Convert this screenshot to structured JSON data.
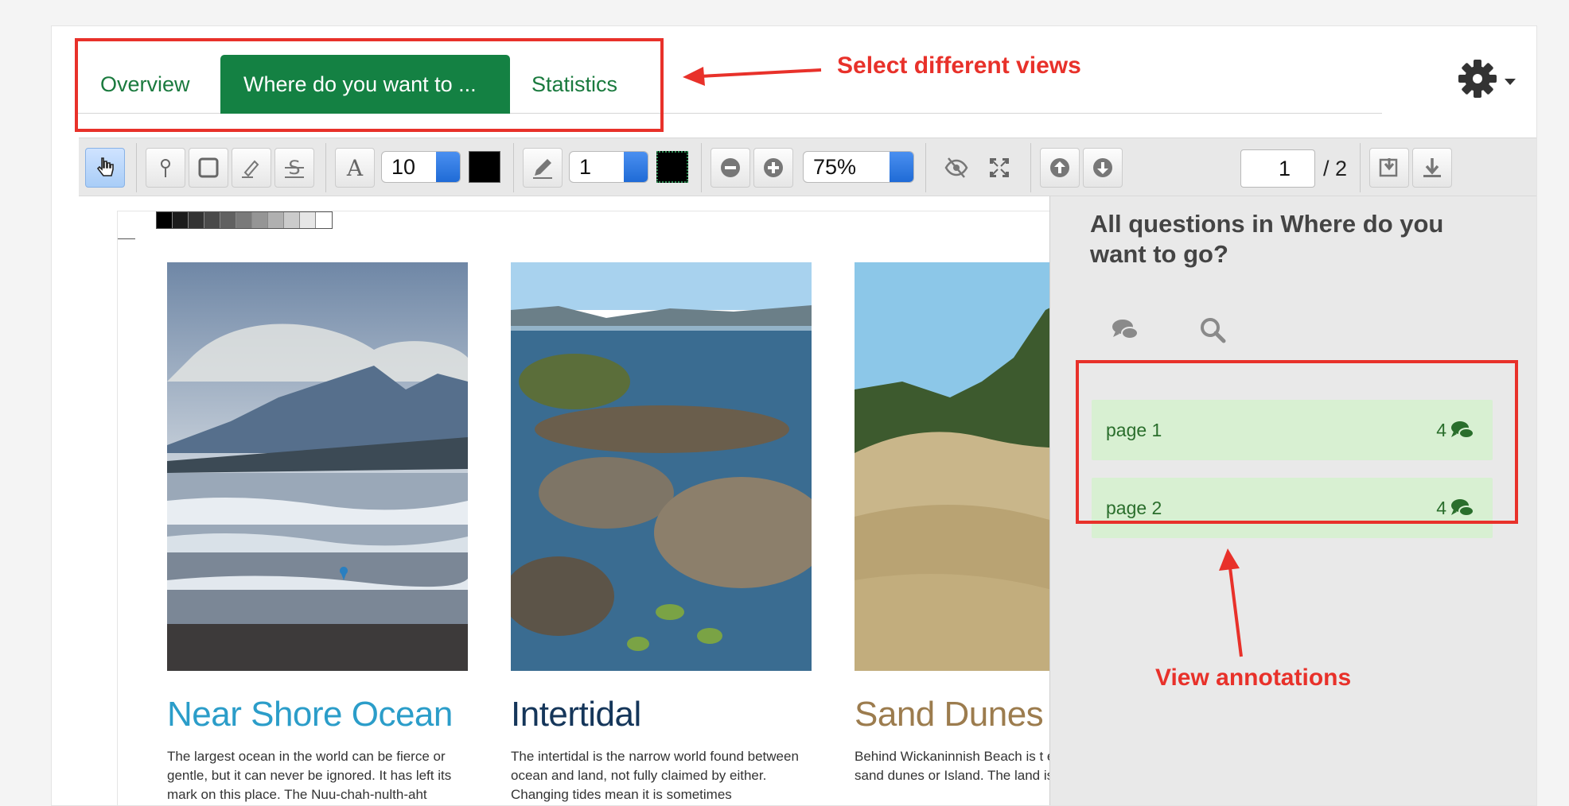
{
  "tabs": [
    {
      "label": "Overview"
    },
    {
      "label": "Where do you want to ..."
    },
    {
      "label": "Statistics"
    }
  ],
  "toolbar": {
    "font_size": "10",
    "line_width": "1",
    "zoom": "75%",
    "page_current": "1",
    "page_total": "/ 2"
  },
  "document": {
    "columns": [
      {
        "title": "Near Shore Ocean",
        "text": "The largest ocean in the world can be fierce or gentle, but it can never be ignored. It has left its mark on this place. The Nuu-chah-nulth-aht"
      },
      {
        "title": "Intertidal",
        "text": "The intertidal is the narrow world found between ocean and land, not fully claimed by either. Changing tides mean it is sometimes"
      },
      {
        "title": "Sand Dunes",
        "text": "Behind Wickaninnish Beach is t extensive area of sand dunes or Island. The land is low enough f"
      }
    ]
  },
  "panel": {
    "title": "All questions in Where do you want to go?",
    "items": [
      {
        "label": "page 1",
        "count": "4"
      },
      {
        "label": "page 2",
        "count": "4"
      }
    ]
  },
  "annotations": {
    "views_label": "Select different views",
    "annotations_label": "View annotations"
  },
  "colors": {
    "accent": "#148143",
    "annotation": "#e8312a",
    "item_bg": "#d8f0d2"
  }
}
